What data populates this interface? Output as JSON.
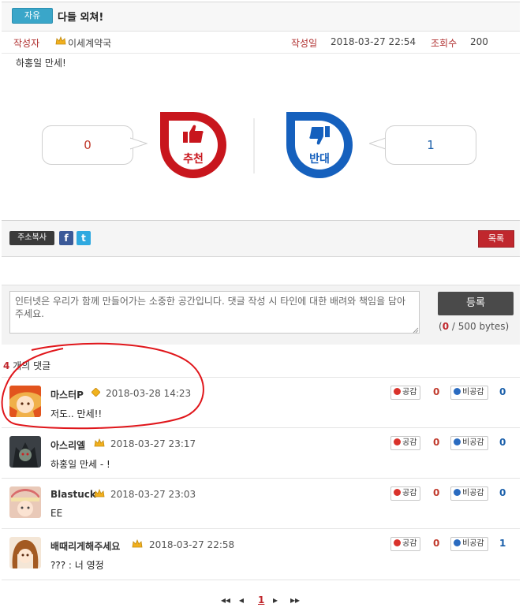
{
  "post": {
    "category": "자유",
    "title": "다들 외쳐!",
    "author_label": "작성자",
    "author": "이세계약국",
    "date_label": "작성일",
    "date": "2018-03-27  22:54",
    "views_label": "조회수",
    "views": "200",
    "body": "하홍일 만세!"
  },
  "votes": {
    "up_count": "0",
    "up_label": "추천",
    "down_count": "1",
    "down_label": "반대"
  },
  "share": {
    "copy_label": "주소복사",
    "facebook_glyph": "f",
    "twitter_glyph": "t",
    "list_label": "목록"
  },
  "comment_form": {
    "placeholder": "인터넷은 우리가 함께 만들어가는 소중한 공간입니다. 댓글 작성 시 타인에 대한 배려와 책임을 담아주세요.",
    "submit_label": "등록",
    "bytes_open": "(",
    "bytes_current": "0",
    "bytes_rest": " / 500 bytes)"
  },
  "comments_header": {
    "count": "4",
    "label": " 개의 댓글"
  },
  "comments": [
    {
      "name": "마스터P",
      "date": "2018-03-28  14:23",
      "text": "저도.. 만세!!",
      "like_label": "공감",
      "like": "0",
      "dislike_label": "비공감",
      "dislike": "0"
    },
    {
      "name": "아스리엘",
      "date": "2018-03-27  23:17",
      "text": "하홍일 만세 - !",
      "like_label": "공감",
      "like": "0",
      "dislike_label": "비공감",
      "dislike": "0"
    },
    {
      "name": "Blastuck",
      "date": "2018-03-27  23:03",
      "text": "EE",
      "like_label": "공감",
      "like": "0",
      "dislike_label": "비공감",
      "dislike": "0"
    },
    {
      "name": "배때리게해주세요",
      "date": "2018-03-27  22:58",
      "text": "??? : 너 영정",
      "like_label": "공감",
      "like": "0",
      "dislike_label": "비공감",
      "dislike": "1"
    }
  ],
  "pager": {
    "first": "◂◂",
    "prev": "◂",
    "current": "1",
    "next": "▸",
    "last": "▸▸"
  },
  "colors": {
    "recommend": "#c8161d",
    "oppose": "#1560bd",
    "accent_badge": "#3aa6c9"
  }
}
